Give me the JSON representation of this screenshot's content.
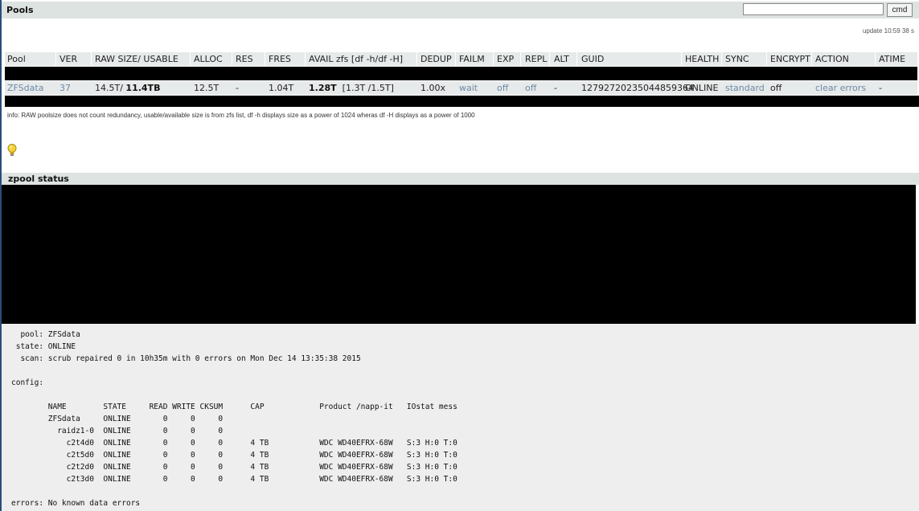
{
  "header": {
    "title": "Pools",
    "cmd_input_value": "",
    "cmd_button_label": "cmd",
    "update_info": "update 10:59 38 s"
  },
  "pool_table": {
    "columns": [
      "Pool",
      "VER",
      "RAW SIZE/ USABLE",
      "ALLOC",
      "RES",
      "FRES",
      "AVAIL zfs [df -h/df -H]",
      "DEDUP",
      "FAILM",
      "EXP",
      "REPL",
      "ALT",
      "GUID",
      "HEALTH",
      "SYNC",
      "ENCRYPT",
      "ACTION",
      "ATIME"
    ],
    "row": {
      "pool": "ZFSdata",
      "ver": "37",
      "raw_size": "14.5T/",
      "usable": "11.4TB",
      "alloc": "12.5T",
      "res": "-",
      "fres": "1.04T",
      "avail": "1.28T",
      "avail_df": "[1.3T /1.5T]",
      "dedup": "1.00x",
      "failm": "wait",
      "exp": "off",
      "repl": "off",
      "alt": "-",
      "guid": "12792720235044859364",
      "health": "ONLINE",
      "sync": "standard",
      "encrypt": "off",
      "action": "clear errors",
      "atime": "-"
    }
  },
  "info_text": "info: RAW poolsize does not count redundancy, usable/available size is from zfs list, df -h displays size as a power of 1024 wheras df -H displays as a power of 1000",
  "icons": {
    "tip": "lightbulb-icon"
  },
  "zpool_status": {
    "title": "zpool status",
    "output": "  pool: ZFSdata\n state: ONLINE\n  scan: scrub repaired 0 in 10h35m with 0 errors on Mon Dec 14 13:35:38 2015\n\nconfig:\n\n        NAME        STATE     READ WRITE CKSUM      CAP            Product /napp-it   IOstat mess\n        ZFSdata     ONLINE       0     0     0\n          raidz1-0  ONLINE       0     0     0\n            c2t4d0  ONLINE       0     0     0      4 TB           WDC WD40EFRX-68W   S:3 H:0 T:0\n            c2t5d0  ONLINE       0     0     0      4 TB           WDC WD40EFRX-68W   S:3 H:0 T:0\n            c2t2d0  ONLINE       0     0     0      4 TB           WDC WD40EFRX-68W   S:3 H:0 T:0\n            c2t3d0  ONLINE       0     0     0      4 TB           WDC WD40EFRX-68W   S:3 H:0 T:0\n\nerrors: No known data errors"
  },
  "colors": {
    "header_bg": "#dde3e0",
    "row_bg": "#e7eaea",
    "link": "#6b8aa6",
    "console_bg": "#eeeeee"
  }
}
